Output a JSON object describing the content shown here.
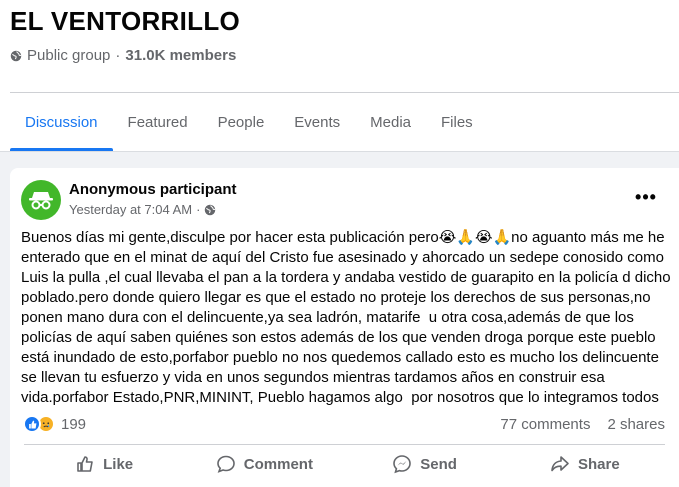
{
  "group": {
    "name": "EL VENTORRILLO",
    "privacy": "Public group",
    "separator": "·",
    "members": "31.0K members"
  },
  "tabs": [
    {
      "label": "Discussion",
      "active": true
    },
    {
      "label": "Featured",
      "active": false
    },
    {
      "label": "People",
      "active": false
    },
    {
      "label": "Events",
      "active": false
    },
    {
      "label": "Media",
      "active": false
    },
    {
      "label": "Files",
      "active": false
    }
  ],
  "post": {
    "author": "Anonymous participant",
    "timestamp": "Yesterday at 7:04 AM",
    "separator": "·",
    "more_label": "•••",
    "text": "Buenos días mi gente,disculpe por hacer esta publicación pero😭🙏😭🙏no aguanto más me he enterado que en el minat de aquí del Cristo fue asesinado y ahorcado un sedepe conosido como Luis la pulla ,el cual llevaba el pan a la tordera y andaba vestido de guarapito en la policía d dicho poblado.pero donde quiero llegar es que el estado no proteje los derechos de sus personas,no ponen mano dura con el delincuente,ya sea ladrón, matarife  u otra cosa,además de que los policías de aquí saben quiénes son estos además de los que venden droga porque este pueblo está inundado de esto,porfabor pueblo no nos quedemos callado esto es mucho los delincuente se llevan tu esfuerzo y vida en unos segundos mientras tardamos años en construir esa vida.porfabor Estado,PNR,MININT, Pueblo hagamos algo  por nosotros que lo integramos todos",
    "reaction_count": "199",
    "comments": "77 comments",
    "shares": "2 shares"
  },
  "actions": {
    "like": "Like",
    "comment": "Comment",
    "send": "Send",
    "share": "Share"
  },
  "icons": [
    "globe-icon",
    "anonymous-icon",
    "like-reaction-icon",
    "sad-reaction-icon",
    "like-icon",
    "comment-icon",
    "send-icon",
    "share-icon"
  ],
  "colors": {
    "accent": "#1877f2",
    "avatar_bg": "#42b72a",
    "sad": "#f7b125"
  }
}
